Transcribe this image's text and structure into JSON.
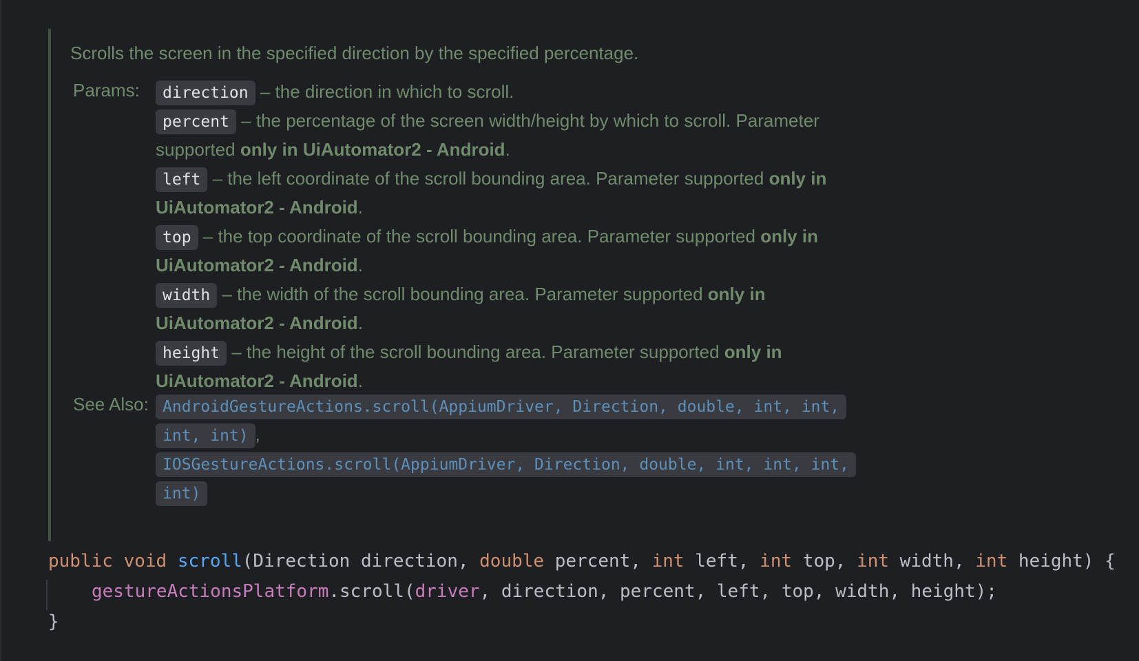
{
  "doc": {
    "summary": "Scrolls the screen in the specified direction by the specified percentage.",
    "params_label": "Params:",
    "params": [
      {
        "name": "direction",
        "line1": " – the direction in which to scroll.",
        "line1_bold": "",
        "line2": "",
        "line2_bold": "",
        "line2_tail": ""
      },
      {
        "name": "percent",
        "line1": " – the percentage of the screen width/height by which to scroll. Parameter",
        "line1_bold": "",
        "line2": "supported ",
        "line2_bold": "only in UiAutomator2 - Android",
        "line2_tail": "."
      },
      {
        "name": "left",
        "line1": " – the left coordinate of the scroll bounding area. Parameter supported ",
        "line1_bold": "only in",
        "line2": "",
        "line2_bold": "UiAutomator2 - Android",
        "line2_tail": "."
      },
      {
        "name": "top",
        "line1": " – the top coordinate of the scroll bounding area. Parameter supported ",
        "line1_bold": "only in",
        "line2": "",
        "line2_bold": "UiAutomator2 - Android",
        "line2_tail": "."
      },
      {
        "name": "width",
        "line1": " – the width of the scroll bounding area. Parameter supported ",
        "line1_bold": "only in",
        "line2": "",
        "line2_bold": "UiAutomator2 - Android",
        "line2_tail": "."
      },
      {
        "name": "height",
        "line1": " – the height of the scroll bounding area. Parameter supported ",
        "line1_bold": "only in",
        "line2": "",
        "line2_bold": "UiAutomator2 - Android",
        "line2_tail": "."
      }
    ],
    "see_also_label": "See Also:",
    "see_also": [
      {
        "line1": "AndroidGestureActions.scroll(AppiumDriver, Direction, double, int, int,",
        "line2": "int, int)",
        "sep": ","
      },
      {
        "line1": "IOSGestureActions.scroll(AppiumDriver, Direction, double, int, int, int,",
        "line2": "int)",
        "sep": ""
      }
    ]
  },
  "code": {
    "kw_public": "public",
    "kw_void": "void",
    "method_name": "scroll",
    "params_start": "(Direction direction, ",
    "kw_double": "double",
    "p_percent": " percent, ",
    "kw_int1": "int",
    "p_left": " left, ",
    "kw_int2": "int",
    "p_top": " top, ",
    "kw_int3": "int",
    "p_width": " width, ",
    "kw_int4": "int",
    "p_height": " height) {",
    "field_gap": "gestureActionsPlatform",
    "call": ".scroll(",
    "field_driver": "driver",
    "args": ", direction, percent, left, top, width, height);",
    "close_brace": "}"
  },
  "colors": {
    "background": "#1e1f22",
    "doc_text": "#6f8b6b",
    "doc_rule": "#415241",
    "chip_bg": "#393b40",
    "link": "#5c8fba",
    "keyword": "#cf8e6d",
    "method": "#56a8f5",
    "field": "#c77dbb",
    "plain_code": "#bcbec4"
  }
}
